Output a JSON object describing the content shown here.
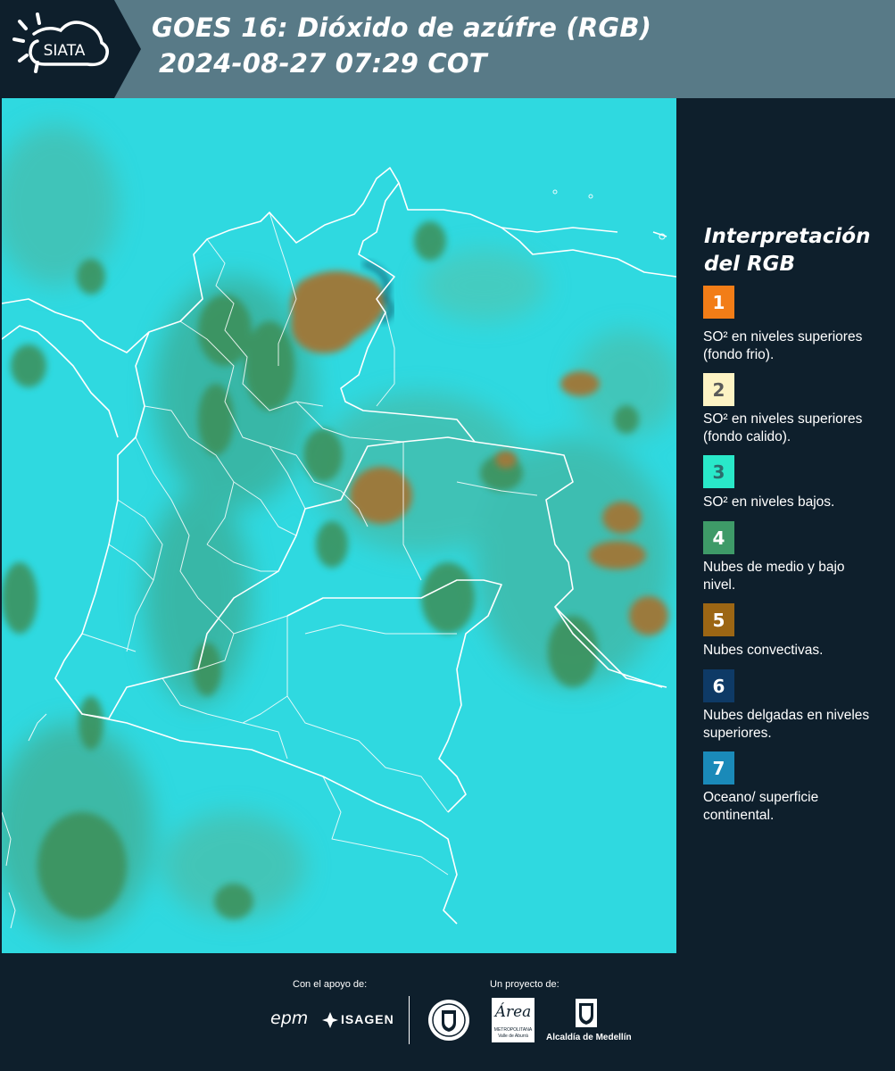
{
  "header": {
    "logo_text": "SIATA",
    "title_line1": "GOES 16: Dióxido de azúfre (RGB)",
    "title_line2": "2024-08-27 07:29 COT"
  },
  "map": {
    "background_color": "#2fd9e0",
    "border_color": "#ffffff"
  },
  "legend": {
    "title": "Interpretación del RGB",
    "items": [
      {
        "number": "1",
        "color": "#f27d17",
        "number_color": "#ffffff",
        "label": "SO² en niveles superiores (fondo frio)."
      },
      {
        "number": "2",
        "color": "#fdf3c4",
        "number_color": "#5a5a5a",
        "label": "SO² en niveles superiores (fondo calido)."
      },
      {
        "number": "3",
        "color": "#29e8c9",
        "number_color": "#2b6d6d",
        "label": "SO² en niveles bajos."
      },
      {
        "number": "4",
        "color": "#3e9a68",
        "number_color": "#ffffff",
        "label": "Nubes de medio y bajo nivel."
      },
      {
        "number": "5",
        "color": "#9c6614",
        "number_color": "#ffffff",
        "label": "Nubes convectivas."
      },
      {
        "number": "6",
        "color": "#0e3a66",
        "number_color": "#ffffff",
        "label": "Nubes delgadas en niveles superiores."
      },
      {
        "number": "7",
        "color": "#1a8ab9",
        "number_color": "#ffffff",
        "label": "Oceano/ superficie continental."
      }
    ]
  },
  "footer": {
    "support_label": "Con el apoyo de:",
    "project_label": "Un proyecto de:",
    "sponsor_epm": "epm",
    "sponsor_isagen": "ISAGEN",
    "amva_name": "Área",
    "amva_sub": "METROPOLITANA",
    "amva_sub2": "Valle de Aburrá",
    "alcaldia": "Alcaldía de Medellín"
  }
}
